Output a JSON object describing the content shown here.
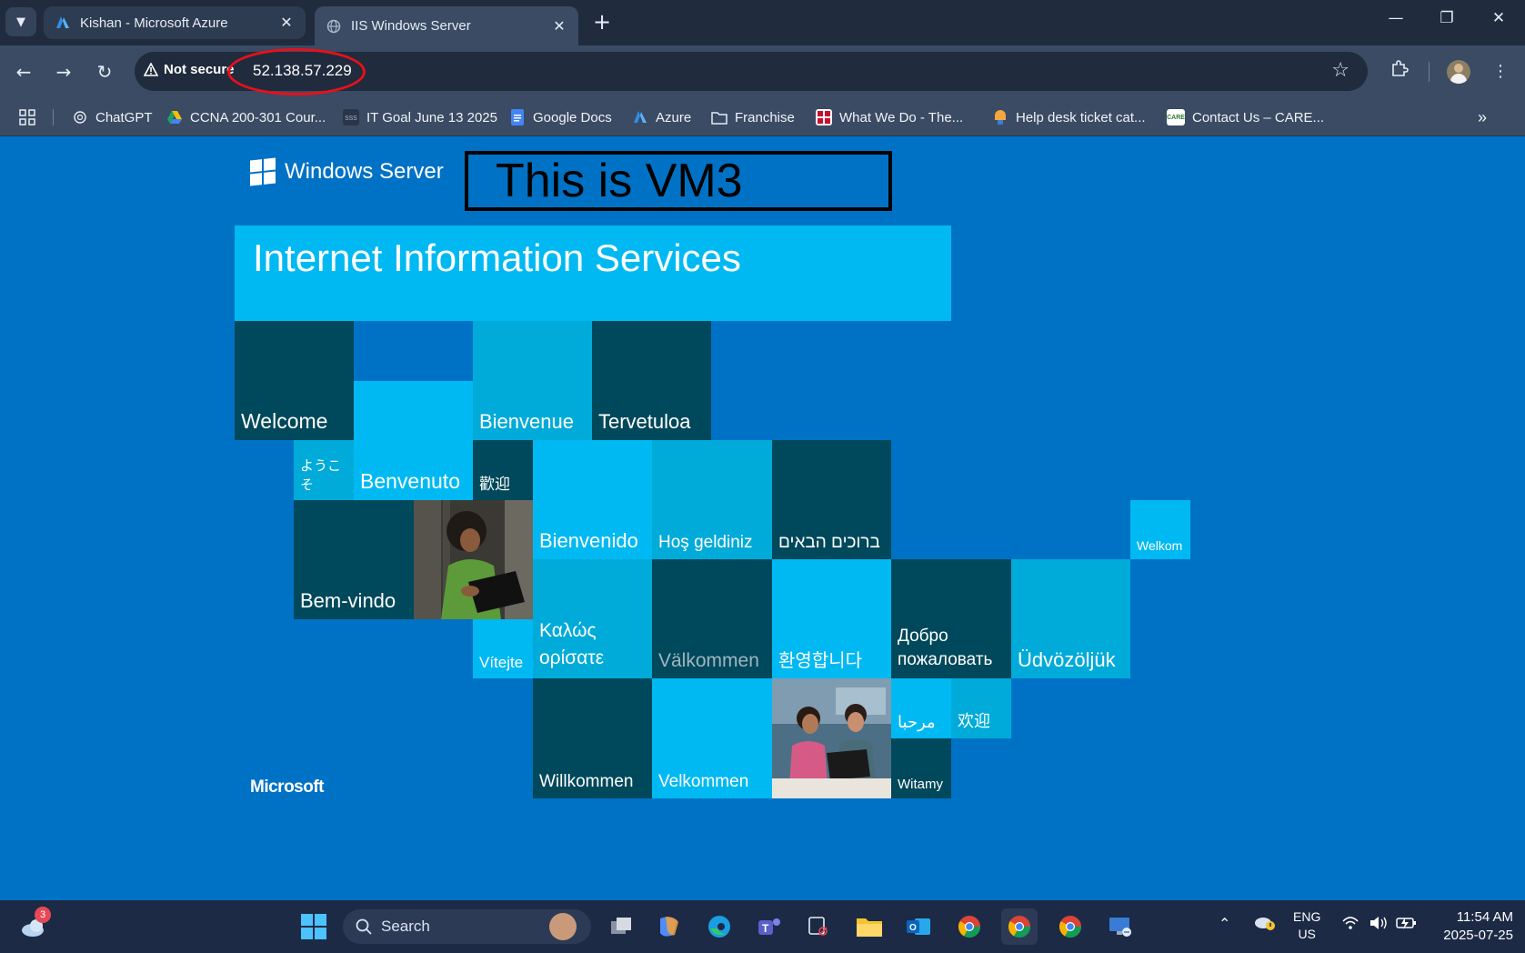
{
  "browser": {
    "tabs": [
      {
        "title": "Kishan - Microsoft Azure",
        "active": false
      },
      {
        "title": "IIS Windows Server",
        "active": true
      }
    ],
    "security_label": "Not secure",
    "url": "52.138.57.229",
    "bookmarks": [
      {
        "label": "ChatGPT",
        "icon": "chatgpt-icon"
      },
      {
        "label": "CCNA 200-301 Cour...",
        "icon": "drive-icon"
      },
      {
        "label": "IT Goal June 13 2025",
        "icon": "page-icon"
      },
      {
        "label": "Google Docs",
        "icon": "docs-icon"
      },
      {
        "label": "Azure",
        "icon": "azure-icon"
      },
      {
        "label": "Franchise",
        "icon": "folder-icon"
      },
      {
        "label": "What We Do - The...",
        "icon": "site-icon"
      },
      {
        "label": "Help desk ticket cat...",
        "icon": "site-icon"
      },
      {
        "label": "Contact Us – CARE...",
        "icon": "care-icon"
      }
    ],
    "annotation_color": "#e8101a"
  },
  "page": {
    "product": "Windows Server",
    "banner": "This is VM3",
    "title": "Internet Information Services",
    "footer_brand": "Microsoft",
    "tiles": {
      "welcome": "Welcome",
      "bienvenue": "Bienvenue",
      "tervetuloa": "Tervetuloa",
      "youkoso": "ようこそ",
      "benvenuto": "Benvenuto",
      "huanying_tw": "歡迎",
      "bienvenido": "Bienvenido",
      "hos_geldiniz": "Hoş geldiniz",
      "bruchim": "ברוכים הבאים",
      "welkom": "Welkom",
      "bem_vindo": "Bem-vindo",
      "vitejte": "Vítejte",
      "kalos_1": "Καλώς",
      "kalos_2": "ορίσατε",
      "valkommen": "Välkommen",
      "hwanyeong": "환영합니다",
      "dobro_1": "Добро",
      "dobro_2": "пожаловать",
      "udvozoljuk": "Üdvözöljük",
      "marhaba": "مرحبا",
      "huanying_cn": "欢迎",
      "willkommen": "Willkommen",
      "velkommen": "Velkommen",
      "witamy": "Witamy"
    },
    "colors": {
      "background": "#0072c6",
      "dark_tile": "#00485b",
      "cyan_tile": "#00b9f2",
      "mid_tile": "#00abd9"
    }
  },
  "taskbar": {
    "weather_badge": "3",
    "search_placeholder": "Search",
    "language_1": "ENG",
    "language_2": "US",
    "time": "11:54 AM",
    "date": "2025-07-25"
  }
}
